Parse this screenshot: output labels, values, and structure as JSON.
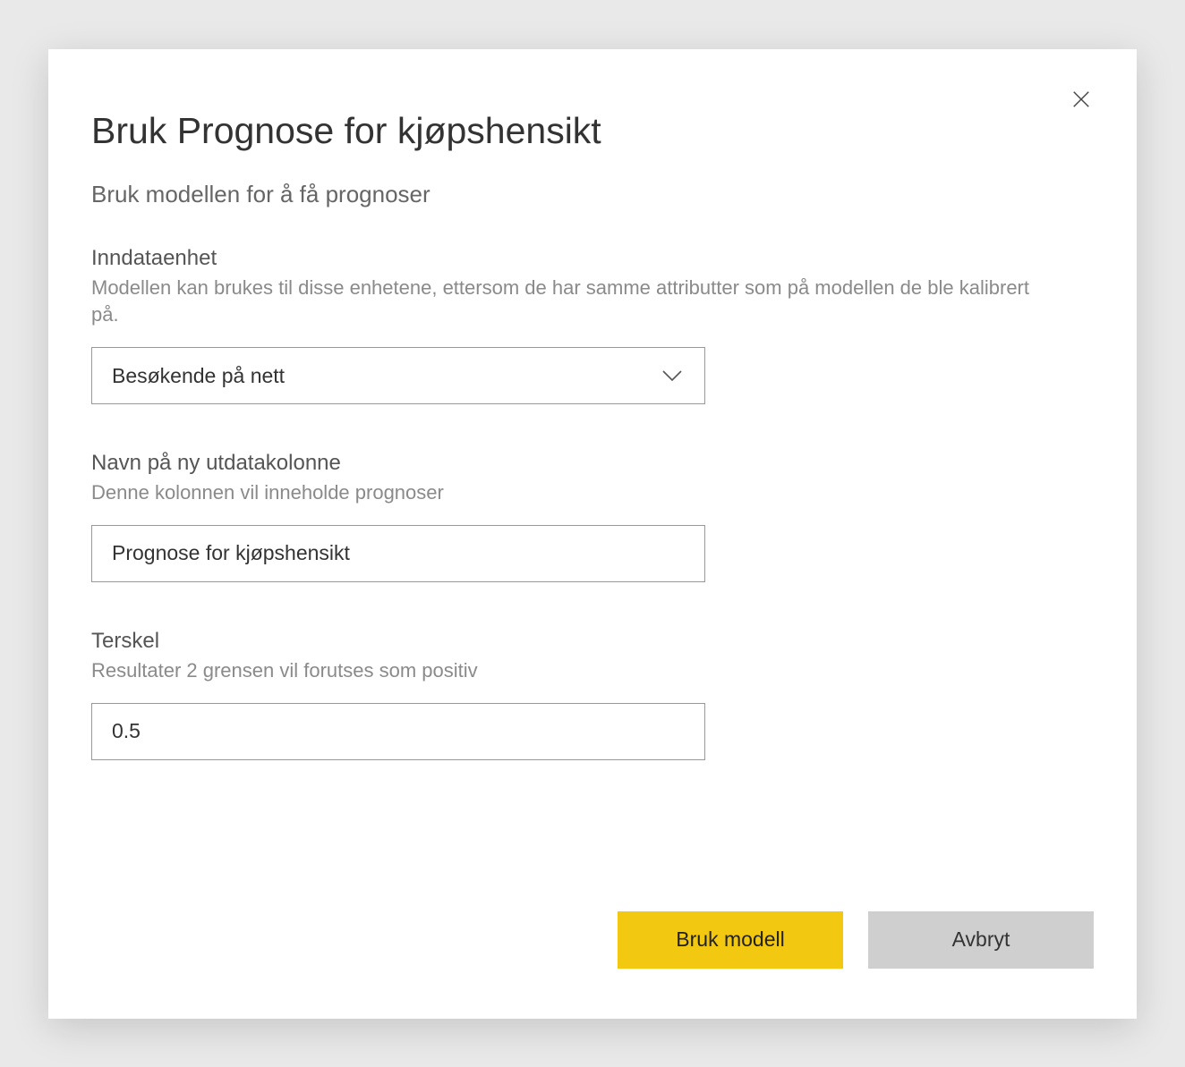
{
  "dialog": {
    "title": "Bruk Prognose for kjøpshensikt",
    "subtitle": "Bruk modellen for å få prognoser"
  },
  "fields": {
    "input_entity": {
      "label": "Inndataenhet",
      "help": "Modellen kan brukes til disse enhetene, ettersom de har samme attributter som på modellen de ble kalibrert på.",
      "selected": "Besøkende på nett"
    },
    "output_column": {
      "label": "Navn på ny utdatakolonne",
      "help": "Denne kolonnen vil inneholde prognoser",
      "value": "Prognose for kjøpshensikt"
    },
    "threshold": {
      "label": "Terskel",
      "help": "Resultater 2 grensen vil forutses som positiv",
      "value": "0.5"
    }
  },
  "footer": {
    "primary": "Bruk modell",
    "secondary": "Avbryt"
  }
}
